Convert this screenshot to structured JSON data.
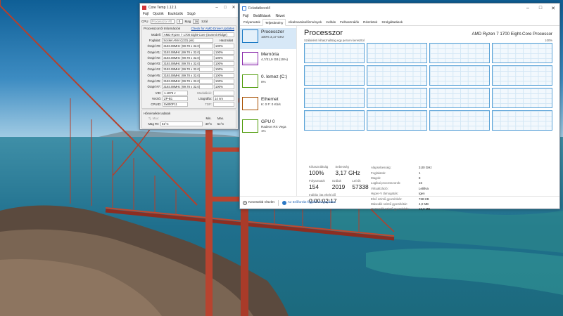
{
  "coretemp": {
    "title": "Core Temp 1.12.1",
    "menu": [
      "Fájl",
      "Opciók",
      "Eszközök",
      "Súgó"
    ],
    "toolbar": {
      "cpu_label": "CPU",
      "cpu_select": "Processzor #0",
      "count1": "0",
      "mag_label": "Mag",
      "count2": "16",
      "szal_label": "Szál"
    },
    "info": {
      "heading": "Processzorról Információk",
      "link": "Check for AMD Driver Updates",
      "model_label": "Modell:",
      "model": "AMD Ryzen 7 1700 Eight-Core (Summit Ridge)",
      "socket_label": "Foglalat:",
      "socket": "Socket AM4 (1331 pin)",
      "usage_header": "Használat",
      "cores": [
        {
          "label": "Órajel #0:",
          "value": "3193.08MHz (99.78 x 32.0)",
          "load": "100%"
        },
        {
          "label": "Órajel #1:",
          "value": "3193.08MHz (99.78 x 32.0)",
          "load": "100%"
        },
        {
          "label": "Órajel #2:",
          "value": "3193.08MHz (99.78 x 32.0)",
          "load": "100%"
        },
        {
          "label": "Órajel #3:",
          "value": "3193.08MHz (99.78 x 32.0)",
          "load": "100%"
        },
        {
          "label": "Órajel #4:",
          "value": "3193.08MHz (99.78 x 32.0)",
          "load": "100%"
        },
        {
          "label": "Órajel #5:",
          "value": "3193.08MHz (99.78 x 32.0)",
          "load": "100%"
        },
        {
          "label": "Órajel #6:",
          "value": "3193.08MHz (99.78 x 32.0)",
          "load": "100%"
        },
        {
          "label": "Órajel #7:",
          "value": "3193.08MHz (99.78 x 32.0)",
          "load": "100%"
        }
      ],
      "vid_label": "VID:",
      "vid": "1.1875 v",
      "modulation_label": "Moduláció:",
      "revision_label": "Verzió:",
      "revision": "ZP-B1",
      "litho_label": "Litográfia:",
      "litho": "14 nm",
      "cpuid_label": "CPUID:",
      "cpuid": "0x800F11",
      "tdp_label": "TDP:"
    },
    "temps": {
      "heading": "Hőmérséklet adatok",
      "tj_label": "Tj. Max:",
      "min_label": "Min.",
      "max_label": "Max.",
      "row_label": "Mag #0:",
      "current": "51°C",
      "min": "30°C",
      "max": "51°C"
    }
  },
  "taskmgr": {
    "title": "Feladatkezelő",
    "menu": [
      "Fájl",
      "Beállítások",
      "Nézet"
    ],
    "tabs": [
      "Folyamatok",
      "Teljesítmény",
      "Alkalmazáselőzmények",
      "Indítás",
      "Felhasználók",
      "Részletek",
      "Szolgáltatások"
    ],
    "active_tab": "Teljesítmény",
    "sidebar": [
      {
        "name": "Processzor",
        "sub": "100% 3,17 GHz",
        "color": "#1a79c4"
      },
      {
        "name": "Memória",
        "sub": "4,7/31,9 GB (15%)",
        "color": "#8b2bab"
      },
      {
        "name": "0. lemez (C:)",
        "sub": "0%",
        "color": "#4d9a06"
      },
      {
        "name": "Ethernet",
        "sub": "K: 0 F: 0 Kb/s",
        "color": "#a74f01"
      },
      {
        "name": "GPU 0",
        "sub": "Radeon RX Vega",
        "sub2": "1%",
        "color": "#4d9a06"
      }
    ],
    "main": {
      "heading": "Processzor",
      "cpu_name": "AMD Ryzen 7 1700 Eight-Core Processor",
      "axis_left": "Szálakénti kihasználtság egy percen keresztül",
      "axis_right": "100%",
      "graph_count": 16
    },
    "stats": {
      "util_label": "Kihasználtság",
      "util": "100%",
      "speed_label": "Sebesség",
      "speed": "3,17 GHz",
      "proc_label": "Folyamatok",
      "proc": "154",
      "threads_label": "Szálak",
      "threads": "2019",
      "handles_label": "Leírók",
      "handles": "57338",
      "uptime_label": "Indítás óta eltelt idő",
      "uptime": "0:00:02:17"
    },
    "details": [
      {
        "k": "Alapsebesség:",
        "v": "3,00 GHz"
      },
      {
        "k": "Foglalatok:",
        "v": "1"
      },
      {
        "k": "Magok:",
        "v": "8"
      },
      {
        "k": "Logikai processzorok:",
        "v": "16"
      },
      {
        "k": "Virtualizáció:",
        "v": "Letiltva"
      },
      {
        "k": "Hyper-V támogatás:",
        "v": "Igen"
      },
      {
        "k": "Első szintű gyorsítótár:",
        "v": "768 KB"
      },
      {
        "k": "Második szintű gyorsítótár:",
        "v": "4,0 MB"
      },
      {
        "k": "Harmadik szintű gyorsítótár:",
        "v": "16,0 MB"
      }
    ],
    "footer": {
      "fewer": "Kevesebb részlet",
      "monitor": "Az Erőforrás-figyelő megnyitása"
    }
  }
}
